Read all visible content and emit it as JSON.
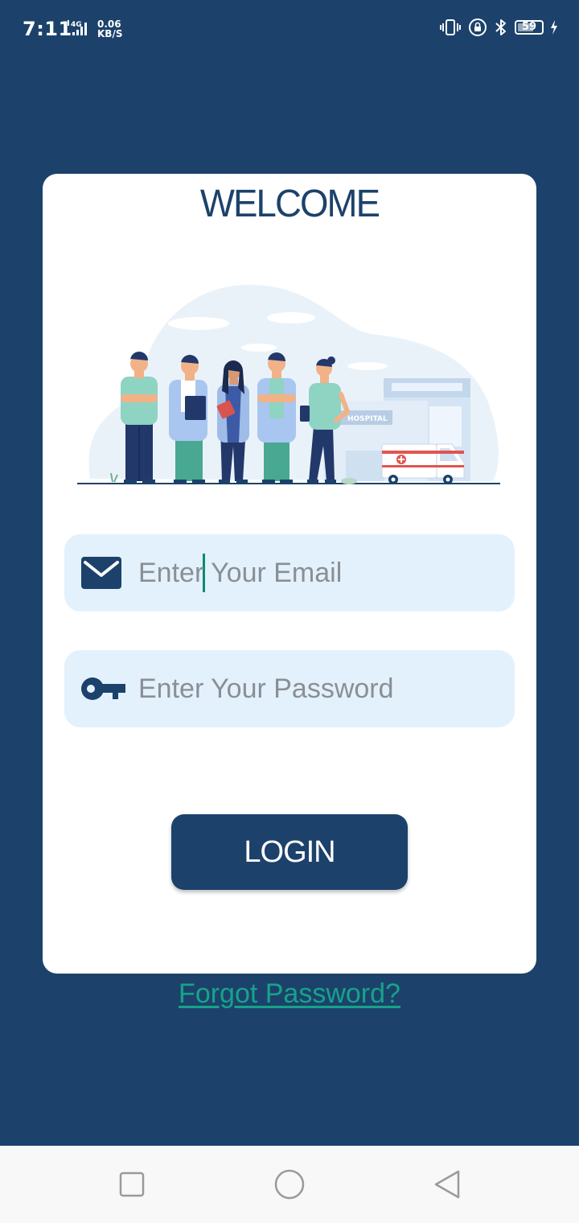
{
  "status_bar": {
    "time": "7:11",
    "network": "4G",
    "speed_value": "0.06",
    "speed_unit": "KB/S",
    "battery_level": "59",
    "icons": [
      "vibrate-icon",
      "lock-rotation-icon",
      "bluetooth-icon",
      "battery-icon",
      "charging-icon"
    ]
  },
  "login": {
    "title": "WELCOME",
    "illustration_label": "HOSPITAL",
    "email_placeholder": "Enter Your Email",
    "password_placeholder": "Enter Your Password",
    "login_label": "LOGIN",
    "forgot_label": "Forgot Password?"
  },
  "navigation": {
    "icons": [
      "recent-apps-icon",
      "home-icon",
      "back-icon"
    ]
  },
  "colors": {
    "primary": "#1c426b",
    "input_background": "#e3f1fc",
    "link": "#16a38a",
    "card": "#ffffff"
  }
}
